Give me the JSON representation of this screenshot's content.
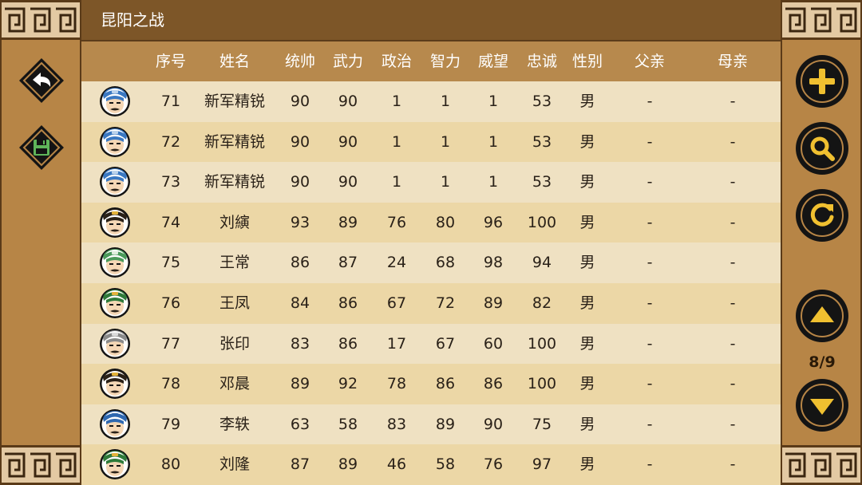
{
  "title": "昆阳之战",
  "columns": {
    "no": "序号",
    "name": "姓名",
    "lead": "统帅",
    "war": "武力",
    "pol": "政治",
    "int": "智力",
    "fame": "威望",
    "loy": "忠诚",
    "sex": "性别",
    "father": "父亲",
    "mother": "母亲"
  },
  "rows": [
    {
      "no": "71",
      "name": "新军精锐",
      "lead": "90",
      "war": "90",
      "pol": "1",
      "int": "1",
      "fame": "1",
      "loy": "53",
      "sex": "男",
      "father": "-",
      "mother": "-",
      "avatar": "blue-helmet-soldier"
    },
    {
      "no": "72",
      "name": "新军精锐",
      "lead": "90",
      "war": "90",
      "pol": "1",
      "int": "1",
      "fame": "1",
      "loy": "53",
      "sex": "男",
      "father": "-",
      "mother": "-",
      "avatar": "blue-helmet-soldier-bearded"
    },
    {
      "no": "73",
      "name": "新军精锐",
      "lead": "90",
      "war": "90",
      "pol": "1",
      "int": "1",
      "fame": "1",
      "loy": "53",
      "sex": "男",
      "father": "-",
      "mother": "-",
      "avatar": "blue-helmet-soldier"
    },
    {
      "no": "74",
      "name": "刘縯",
      "lead": "93",
      "war": "89",
      "pol": "76",
      "int": "80",
      "fame": "96",
      "loy": "100",
      "sex": "男",
      "father": "-",
      "mother": "-",
      "avatar": "crowned-lord"
    },
    {
      "no": "75",
      "name": "王常",
      "lead": "86",
      "war": "87",
      "pol": "24",
      "int": "68",
      "fame": "98",
      "loy": "94",
      "sex": "男",
      "father": "-",
      "mother": "-",
      "avatar": "green-helmet-general"
    },
    {
      "no": "76",
      "name": "王凤",
      "lead": "84",
      "war": "86",
      "pol": "67",
      "int": "72",
      "fame": "89",
      "loy": "82",
      "sex": "男",
      "father": "-",
      "mother": "-",
      "avatar": "green-hood-general"
    },
    {
      "no": "77",
      "name": "张印",
      "lead": "83",
      "war": "86",
      "pol": "17",
      "int": "67",
      "fame": "60",
      "loy": "100",
      "sex": "男",
      "father": "-",
      "mother": "-",
      "avatar": "grey-eyepatch-general"
    },
    {
      "no": "78",
      "name": "邓晨",
      "lead": "89",
      "war": "92",
      "pol": "78",
      "int": "86",
      "fame": "86",
      "loy": "100",
      "sex": "男",
      "father": "-",
      "mother": "-",
      "avatar": "crowned-official"
    },
    {
      "no": "79",
      "name": "李轶",
      "lead": "63",
      "war": "58",
      "pol": "83",
      "int": "89",
      "fame": "90",
      "loy": "75",
      "sex": "男",
      "father": "-",
      "mother": "-",
      "avatar": "blue-cap-official"
    },
    {
      "no": "80",
      "name": "刘隆",
      "lead": "87",
      "war": "89",
      "pol": "46",
      "int": "58",
      "fame": "76",
      "loy": "97",
      "sex": "男",
      "father": "-",
      "mother": "-",
      "avatar": "green-hood-general"
    }
  ],
  "page_indicator": "8/9",
  "buttons": {
    "back": "back-arrow-icon",
    "save": "floppy-save-icon",
    "add": "plus-icon",
    "search": "magnifier-icon",
    "refresh": "refresh-icon",
    "page_up": "triangle-up-icon",
    "page_down": "triangle-down-icon"
  },
  "colors": {
    "title_bar": "#7d5628",
    "header_bar": "#b7894d",
    "row_light": "#efe1c2",
    "row_dark": "#ecd7a6",
    "side_panel": "#b78546",
    "save_icon_green": "#5fb55a"
  }
}
